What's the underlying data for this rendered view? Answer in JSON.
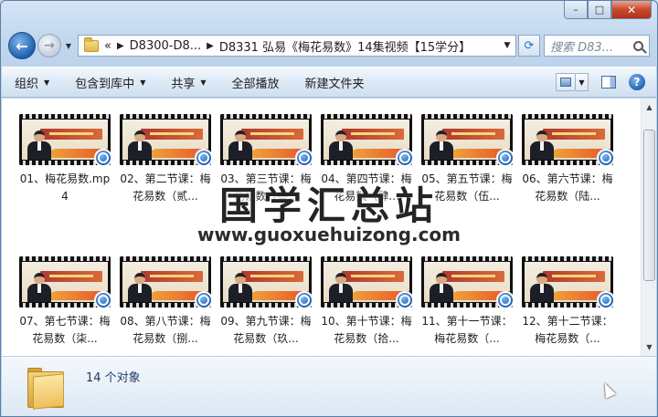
{
  "window": {
    "minimize_icon": "minimize-icon",
    "maximize_icon": "maximize-icon",
    "close_icon": "close-icon"
  },
  "nav": {
    "back_icon": "back-arrow-icon",
    "forward_icon": "forward-arrow-icon",
    "breadcrumb_overflow": "«",
    "breadcrumb": [
      "D8300-D8...",
      "D8331 弘易《梅花易数》14集视频【15学分】"
    ],
    "search_placeholder": "搜索 D83..."
  },
  "toolbar": {
    "organize": "组织",
    "include_in_library": "包含到库中",
    "share": "共享",
    "play_all": "全部播放",
    "new_folder": "新建文件夹",
    "help": "?"
  },
  "files": [
    {
      "name": "01、梅花易数.mp4"
    },
    {
      "name": "02、第二节课：梅花易数（贰..."
    },
    {
      "name": "03、第三节课：梅花易数（叁..."
    },
    {
      "name": "04、第四节课：梅花易数（肆..."
    },
    {
      "name": "05、第五节课：梅花易数（伍..."
    },
    {
      "name": "06、第六节课：梅花易数（陆..."
    },
    {
      "name": "07、第七节课：梅花易数（柒..."
    },
    {
      "name": "08、第八节课：梅花易数（捌..."
    },
    {
      "name": "09、第九节课：梅花易数（玖..."
    },
    {
      "name": "10、第十节课：梅花易数（拾..."
    },
    {
      "name": "11、第十一节课：梅花易数（..."
    },
    {
      "name": "12、第十二节课：梅花易数（..."
    }
  ],
  "watermark": {
    "title": "国学汇总站",
    "url": "www.guoxuehuizong.com"
  },
  "status": {
    "count": "14 个对象"
  }
}
